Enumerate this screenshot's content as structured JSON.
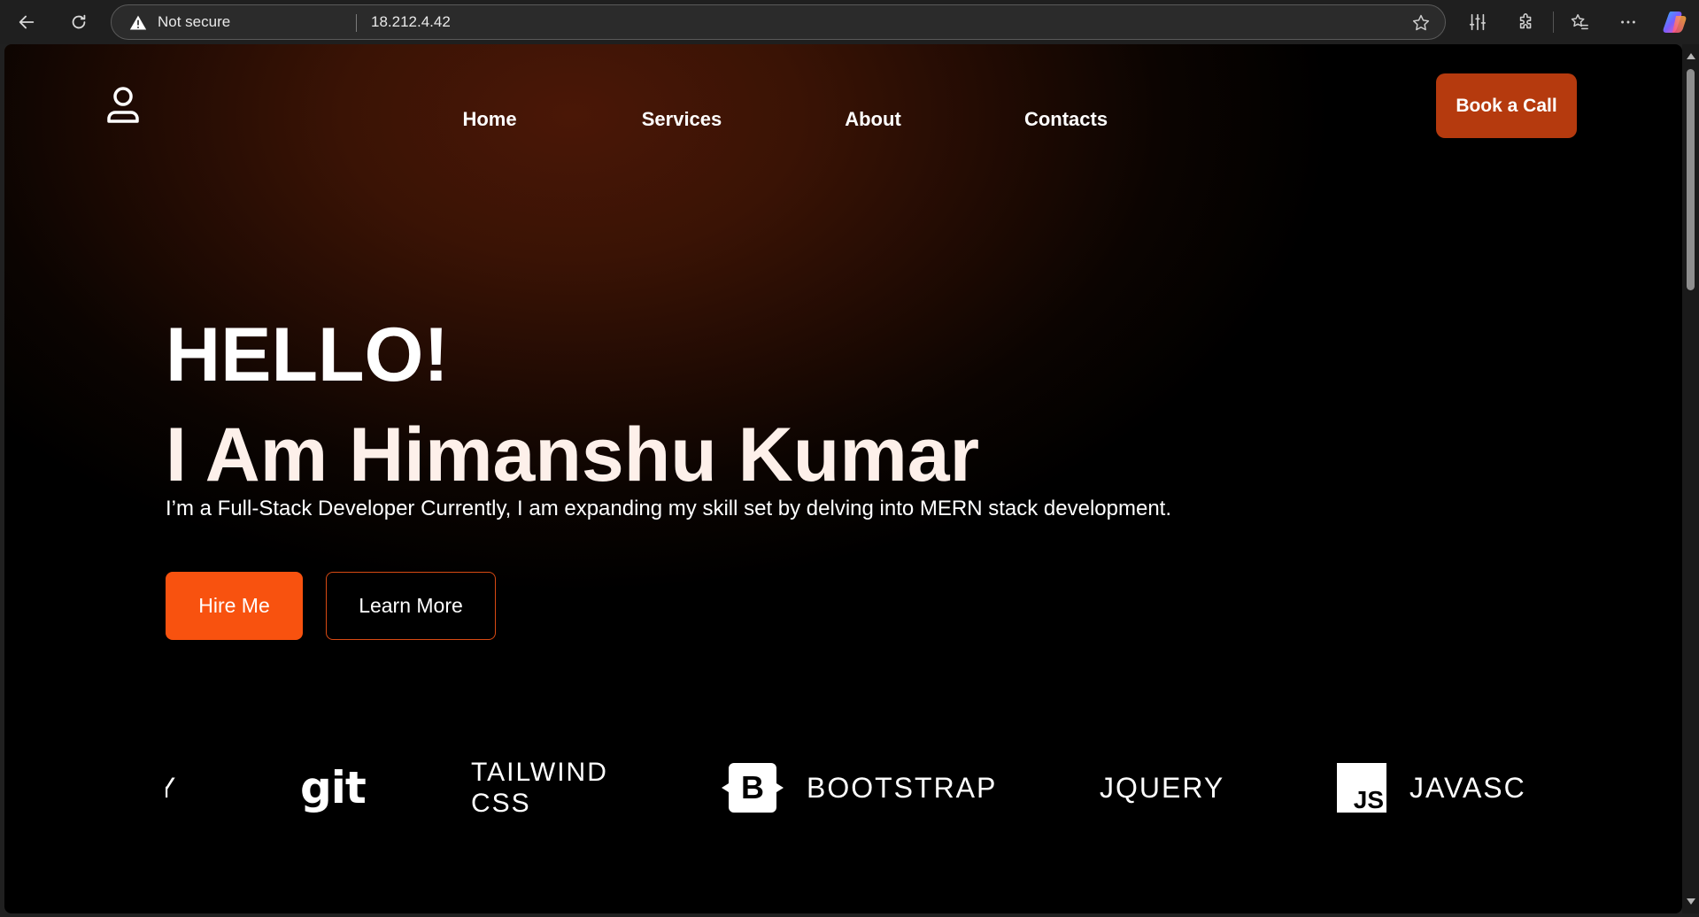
{
  "browser": {
    "security_label": "Not secure",
    "url": "18.212.4.42"
  },
  "site": {
    "nav": [
      {
        "label": "Home"
      },
      {
        "label": "Services"
      },
      {
        "label": "About"
      },
      {
        "label": "Contacts"
      }
    ],
    "book_call": "Book a Call"
  },
  "hero": {
    "greeting": "HELLO!",
    "name_line": "I Am Himanshu Kumar",
    "description": "I’m a Full-Stack Developer Currently, I am expanding my skill set by delving into MERN stack development.",
    "hire_button": "Hire Me",
    "learn_button": "Learn More"
  },
  "tech": {
    "partial": "Y",
    "git": "git",
    "tailwind": "TAILWIND CSS",
    "bootstrap_badge": "B",
    "bootstrap": "BOOTSTRAP",
    "jquery": "JQUERY",
    "js_badge": "JS",
    "javascript": "JAVASC"
  },
  "icons": {
    "back": "arrow-left-icon",
    "reload": "reload-icon",
    "warning": "warning-icon",
    "favorite": "star-icon",
    "settings": "sliders-icon",
    "extensions": "puzzle-icon",
    "favorites": "favorites-icon",
    "menu": "more-icon",
    "copilot": "copilot-icon",
    "profile": "user-icon"
  },
  "colors": {
    "accent": "#f8520f",
    "book_button": "#b53a0e",
    "hero_glow": "#4a1706",
    "background": "#000000"
  }
}
